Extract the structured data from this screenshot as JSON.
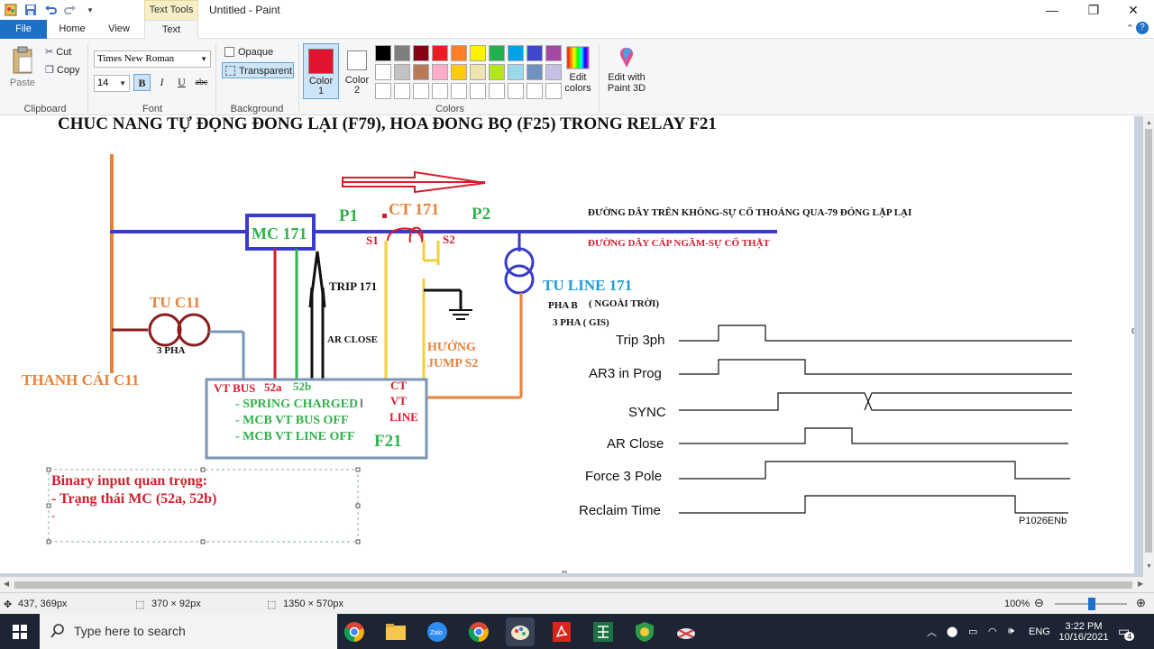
{
  "window": {
    "title": "Untitled - Paint",
    "tool_tab_group": "Text Tools"
  },
  "tabs": [
    {
      "label": "File"
    },
    {
      "label": "Home"
    },
    {
      "label": "View"
    },
    {
      "label": "Text"
    }
  ],
  "ribbon": {
    "clipboard": {
      "paste": "Paste",
      "cut": "Cut",
      "copy": "Copy",
      "group": "Clipboard"
    },
    "font": {
      "family": "Times New Roman",
      "size": "14",
      "bold": "B",
      "italic": "I",
      "underline": "U",
      "strike": "abc",
      "group": "Font"
    },
    "background": {
      "opaque": "Opaque",
      "transparent": "Transparent",
      "group": "Background"
    },
    "colors": {
      "color1_line1": "Color",
      "color1_line2": "1",
      "color2_line1": "Color",
      "color2_line2": "2",
      "edit_line1": "Edit",
      "edit_line2": "colors",
      "group": "Colors",
      "color1_value": "#e0142c",
      "color2_value": "#ffffff",
      "palette": [
        "#000000",
        "#7f7f7f",
        "#880015",
        "#ed1c24",
        "#ff7f27",
        "#fff200",
        "#22b14c",
        "#00a2e8",
        "#3f48cc",
        "#a349a4",
        "#ffffff",
        "#c3c3c3",
        "#b97a57",
        "#ffaec9",
        "#ffc90e",
        "#efe4b0",
        "#b5e61d",
        "#99d9ea",
        "#7092be",
        "#c8bfe7",
        "#ffffff",
        "#ffffff",
        "#ffffff",
        "#ffffff",
        "#ffffff",
        "#ffffff",
        "#ffffff",
        "#ffffff",
        "#ffffff",
        "#ffffff"
      ]
    },
    "paint3d": {
      "line1": "Edit with",
      "line2": "Paint 3D"
    }
  },
  "diagram": {
    "title": "CHUC NANG TỰ ĐỘNG ĐONG LẠI (F79), HOA ĐONG BỘ (F25) TRONG RELAY F21",
    "mc": "MC 171",
    "p1": "P1",
    "ct": "CT 171",
    "p2": "P2",
    "s1": "S1",
    "s2": "S2",
    "note_overhead": "ĐƯỜNG DÂY TRÊN KHÔNG-SỰ CỐ THOÁNG QUA-79 ĐÓNG LẶP LẠI",
    "note_cable": "ĐƯỜNG DÂY CÁP NGẦM-SỰ CỐ THẬT",
    "trip": "TRIP 171",
    "ar_close": "AR CLOSE",
    "tu_c11": "TU C11",
    "three_pha": "3 PHA",
    "thanh_cai": "THANH CÁI C11",
    "tu_line": "TU LINE 171",
    "pha_b": "PHA B",
    "ngoai_troi": "( NGOÀI TRỜI)",
    "gis": "3 PHA ( GIS)",
    "huong_1": "HƯỚNG",
    "huong_2": "JUMP S2",
    "vt_bus": "VT BUS",
    "c52a": "52a",
    "c52b": "52b",
    "ct_vt_line_1": "CT",
    "ct_vt_line_2": "VT",
    "ct_vt_line_3": "LINE",
    "spring": "- SPRING CHARGED",
    "mcb_bus": "- MCB VT BUS OFF",
    "mcb_line": "- MCB VT LINE OFF",
    "f21": "F21",
    "binary_title": "Binary input quan trọng:",
    "binary_item": "- Trạng thái MC (52a, 52b)",
    "binary_dash": "-"
  },
  "timing": {
    "signals": [
      "Trip 3ph",
      "AR3 in Prog",
      "SYNC",
      "AR Close",
      "Force 3 Pole",
      "Reclaim Time"
    ],
    "ref": "P1026ENb"
  },
  "status": {
    "cursor": "437, 369px",
    "selection": "370 × 92px",
    "canvas_size": "1350 × 570px",
    "zoom": "100%"
  },
  "taskbar": {
    "search_placeholder": "Type here to search",
    "lang": "ENG",
    "time": "3:22 PM",
    "date": "10/16/2021",
    "notif_count": "4"
  }
}
